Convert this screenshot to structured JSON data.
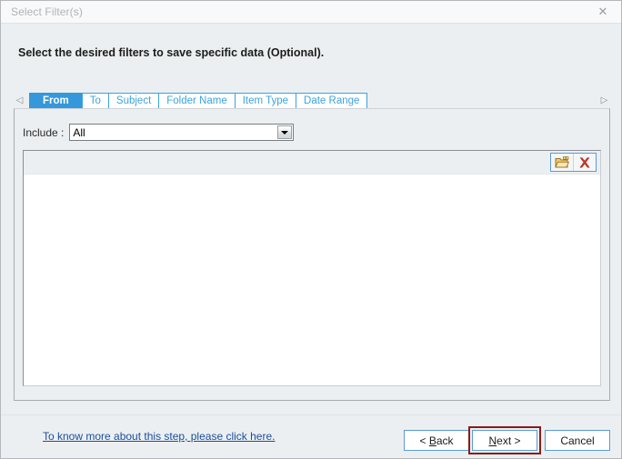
{
  "window": {
    "title": "Select Filter(s)",
    "close_icon": "close-icon",
    "heading": "Select the desired filters to save specific data (Optional)."
  },
  "tabs": {
    "scroll_left_icon": "◁",
    "scroll_right_icon": "▷",
    "items": [
      {
        "label": "From",
        "active": true
      },
      {
        "label": "To",
        "active": false
      },
      {
        "label": "Subject",
        "active": false
      },
      {
        "label": "Folder Name",
        "active": false
      },
      {
        "label": "Item Type",
        "active": false
      },
      {
        "label": "Date Range",
        "active": false
      }
    ]
  },
  "filter_panel": {
    "include_label": "Include :",
    "include_value": "All",
    "include_options": [
      "All"
    ],
    "toolbar": {
      "browse_icon": "open-folder-icon",
      "remove_icon": "red-x-delete-icon"
    },
    "list_items": []
  },
  "footer": {
    "help_link": "To know more about this step, please click here.",
    "buttons": {
      "back": {
        "prefix": "< ",
        "accel": "B",
        "suffix": "ack"
      },
      "next": {
        "prefix": "",
        "accel": "N",
        "suffix": "ext >"
      },
      "cancel": {
        "label": "Cancel"
      }
    },
    "highlight_color": "#8b1a1a"
  },
  "colors": {
    "accent_blue": "#3498db",
    "tab_border": "#39a3e0",
    "window_bg": "#eceff1",
    "titlebar_bg": "#f8f9fa",
    "link": "#1a4f9c"
  }
}
